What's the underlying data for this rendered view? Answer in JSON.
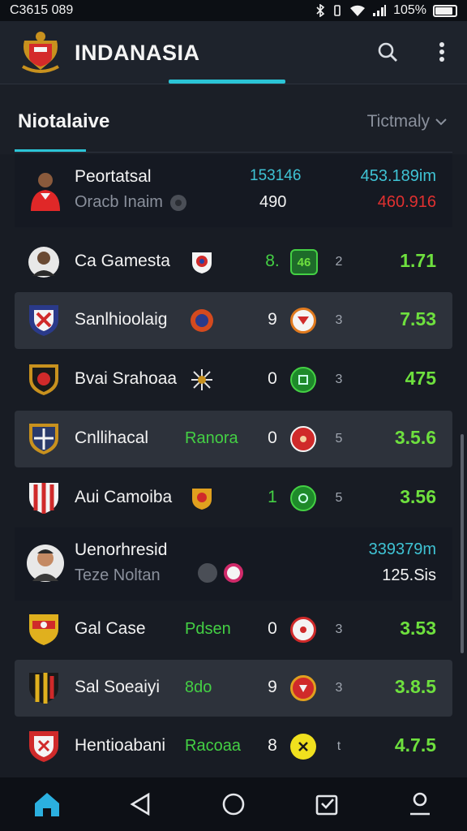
{
  "status_bar": {
    "time": "C3615 089",
    "battery": "105%"
  },
  "app_bar": {
    "title": "INDANASIA",
    "search_icon": "search-icon",
    "menu_icon": "more-vert-icon"
  },
  "section": {
    "title": "Niotalaive",
    "filter_label": "Tictmaly"
  },
  "featured": [
    {
      "name": "Peortatsal",
      "sub": "Oracb Inaim",
      "center_top": "153146",
      "center_bottom": "490",
      "right_top": "453.189im",
      "right_bottom": "460.916"
    },
    {
      "name": "Uenorhresid",
      "sub": "Teze Noltan",
      "center_top": "",
      "center_bottom": "",
      "right_top": "339379m",
      "right_bottom": "125.Sis"
    }
  ],
  "rows": [
    {
      "name": "Ca Gamesta",
      "tag": "",
      "score": "8.",
      "ball": "46",
      "small": "2",
      "value": "1.71"
    },
    {
      "name": "Sanlhioolaig",
      "tag": "",
      "score": "9",
      "ball": "",
      "small": "3",
      "value": "7.53"
    },
    {
      "name": "Bvai Srahoaa",
      "tag": "",
      "score": "0",
      "ball": "",
      "small": "3",
      "value": "475"
    },
    {
      "name": "Cnllihacal",
      "tag": "Ranora",
      "score": "0",
      "ball": "",
      "small": "5",
      "value": "3.5.6"
    },
    {
      "name": "Aui Camoiba",
      "tag": "",
      "score": "1",
      "ball": "",
      "small": "5",
      "value": "3.56"
    },
    {
      "name": "Gal Case",
      "tag": "Pdsen",
      "score": "0",
      "ball": "",
      "small": "3",
      "value": "3.53"
    },
    {
      "name": "Sal Soeaiyi",
      "tag": "8do",
      "score": "9",
      "ball": "",
      "small": "3",
      "value": "3.8.5"
    },
    {
      "name": "Hentioabani",
      "tag": "Racoaa",
      "score": "8",
      "ball": "",
      "small": "t",
      "value": "4.7.5"
    }
  ],
  "colors": {
    "accent": "#2bc4d6",
    "value_green": "#6ee03e",
    "alert_red": "#e03030"
  }
}
